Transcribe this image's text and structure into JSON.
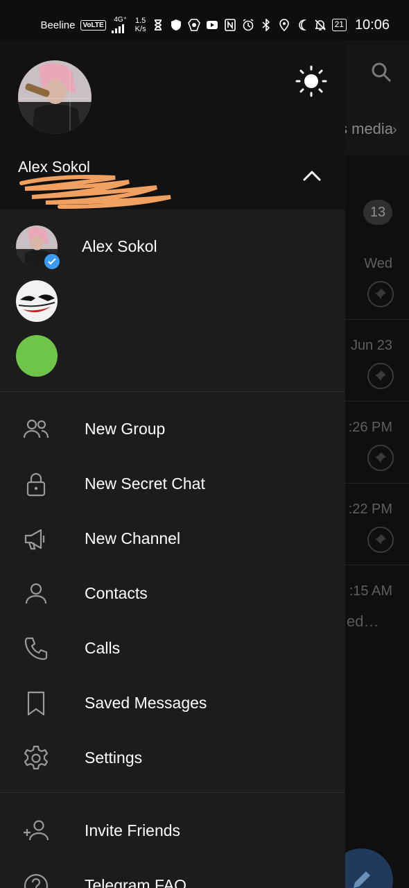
{
  "status_bar": {
    "carrier": "Beeline",
    "volte": "VoLTE",
    "network": "4G⁺",
    "speed_value": "1.5",
    "speed_unit": "K/s",
    "battery": "21",
    "time": "10:06"
  },
  "background_chats": {
    "tab_partial": "s media",
    "unread_count": "13",
    "times": [
      "Wed",
      "Jun 23",
      ":26 PM",
      ":22 PM",
      ":15 AM"
    ],
    "snippet_partial": "ed…"
  },
  "profile": {
    "name": "Alex Sokol"
  },
  "accounts": [
    {
      "name": "Alex Sokol",
      "verified": true,
      "avatar": "photo"
    },
    {
      "name": "",
      "avatar": "joker"
    },
    {
      "name": "",
      "avatar": "green"
    }
  ],
  "menu": [
    {
      "label": "New Group",
      "icon": "group-icon"
    },
    {
      "label": "New Secret Chat",
      "icon": "lock-icon"
    },
    {
      "label": "New Channel",
      "icon": "megaphone-icon"
    },
    {
      "label": "Contacts",
      "icon": "person-icon"
    },
    {
      "label": "Calls",
      "icon": "phone-icon"
    },
    {
      "label": "Saved Messages",
      "icon": "bookmark-icon"
    },
    {
      "label": "Settings",
      "icon": "gear-icon"
    }
  ],
  "menu_secondary": [
    {
      "label": "Invite Friends",
      "icon": "add-person-icon"
    },
    {
      "label": "Telegram FAQ",
      "icon": "help-icon"
    }
  ],
  "colors": {
    "drawer_bg": "#1c1c1c",
    "header_bg": "#121212",
    "accent_blue": "#3a9bf0",
    "green_avatar": "#6fc44a",
    "scribble_orange": "#f0a060"
  }
}
